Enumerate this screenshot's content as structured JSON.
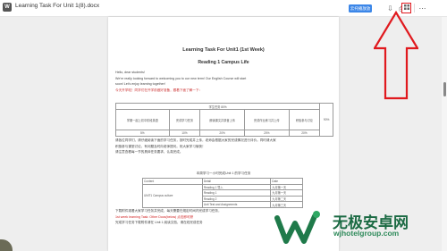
{
  "header": {
    "doc_badge": "W",
    "doc_title": "Learning Task For Unit 1(8).docx",
    "primary_button": "云托播放放",
    "icons": [
      "download-icon",
      "print-icon",
      "grid-icon",
      "more-icon"
    ]
  },
  "page": {
    "title": "Learning Task For Unit1 (1st Week)",
    "subtitle": "Reading 1 Campus Life",
    "intro_lines": [
      "Hello, dear students!",
      "We're really looking forward to welcoming you to our new term! Our English Course will start",
      "soon! Let's enjoy learning together!",
      "今天开学啦！同学们在开学前做好准备，跟着下面了解一下："
    ],
    "table1": {
      "header": "学生任务 80%",
      "cells": [
        "学期一起上初中阶段英语",
        "完成学习任务",
        "朗读课文并录音上传",
        "完成作业练习并上传",
        "积极参与讨论",
        "90%"
      ],
      "percents": [
        "5%",
        "10%",
        "20%",
        "20%",
        "20%"
      ]
    },
    "middle_lines": [
      "请各位同学们，请仔细阅读下面的学习任务，按时完成并上传，老师会根据大家的完成情况进行评价。同时请大家",
      "积极参与课堂讨论，有问题及时向老师提问。祝大家学习愉快！",
      "请注意查看每一节的具体任务要求，认真完成。"
    ],
    "table2_title": "本周学习一小时完成Unit 1 的学习任务",
    "table2": {
      "headers": [
        "Content",
        "Detail",
        "Date"
      ],
      "rows": [
        [
          "UNIT1 Campus culture",
          "Reading 1 导入",
          "九月第一天"
        ],
        [
          "",
          "Reading 1",
          "九月第一天"
        ],
        [
          "",
          "Reading 2",
          "九月第二天"
        ],
        [
          "",
          "Unit Test and Assignments",
          "九月第三天"
        ]
      ]
    },
    "bottom_lines": [
      "下载附件观看大家学习任务并完成，每天需要在规定时间内完成学习任务，",
      "1st week learning Task: Other Docs(below) 点击即可获",
      "完成学习任务下载附件请在 Unit 1 阅读文档，请在线完成任务"
    ]
  },
  "watermark": {
    "name": "无极安卓网",
    "url": "wjhotelgroup.com"
  }
}
